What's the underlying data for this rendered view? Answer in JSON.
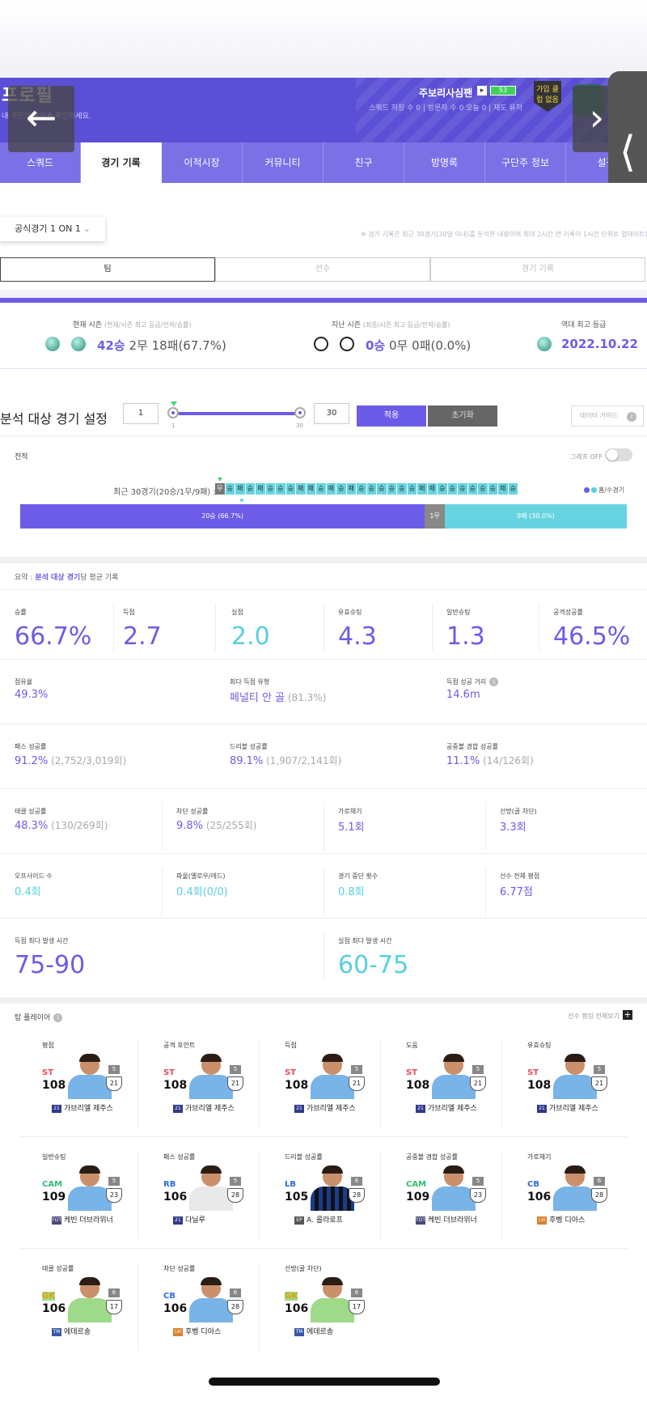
{
  "header": {
    "title": "프로필",
    "subtitle": "내 구단의 정보를 확인하세요.",
    "manager_name": "주보리사심팬",
    "level": "53",
    "meta": "스쿼드 저장 수 0 | 방문자 수 0 오늘 0 | 재도 유저",
    "club_badge": "가입 클럽 없음"
  },
  "tabs": [
    "스쿼드",
    "경기 기록",
    "이적시장",
    "커뮤니티",
    "친구",
    "방명록",
    "구단주 정보",
    "설정"
  ],
  "active_tab": "경기 기록",
  "filter": {
    "mode": "공식경기 1 ON 1",
    "note": "※ 경기 기록은 최근 30경기(30일 이내)를 분석한 내용이며 최대 2시간 전 기록이 1시간 단위로 업데이트됩니다."
  },
  "subtabs": [
    "팀",
    "선수",
    "경기 기록"
  ],
  "season": {
    "current_label": "현재 시즌",
    "current_sub": "(현재/시즌 최고 등급/전적/승률)",
    "current_win": "42승",
    "current_rest": " 2무 18패(67.7%)",
    "last_label": "지난 시즌",
    "last_sub": "(최종/시즌 최고 등급/전적/승률)",
    "last_win": "0승",
    "last_rest": " 0무 0패(0.0%)",
    "best_label": "역대 최고 등급",
    "best_date": "2022.10.22"
  },
  "analysis": {
    "title": "분석 대상 경기 설정",
    "min": "1",
    "max": "30",
    "tick_min": "1",
    "tick_max": "30",
    "apply": "적용",
    "reset": "초기화",
    "guide": "데이터 가이드"
  },
  "record": {
    "title": "전적",
    "toggle_label": "그래프 OFF",
    "recent_label": "최근 30경기(20승/1무/9패) :",
    "home_legend": "홈/수경기",
    "results": [
      "무",
      "승",
      "패",
      "승",
      "패",
      "승",
      "승",
      "승",
      "패",
      "패",
      "승",
      "패",
      "승",
      "패",
      "승",
      "승",
      "승",
      "승",
      "승",
      "승",
      "패",
      "패",
      "승",
      "승",
      "승",
      "승",
      "승",
      "승",
      "패",
      "승"
    ],
    "win_label": "20승 (66.7%)",
    "draw_label": "1무",
    "loss_label": "9패 (30.0%)",
    "win_pct": 66.7,
    "draw_pct": 3.3,
    "loss_pct": 30.0
  },
  "summary": {
    "prefix": "요약 : ",
    "highlight": "분석 대상 경기",
    "suffix": "당 평균 기록",
    "win_rate_l": "승률",
    "win_rate": "66.7%",
    "goals_l": "득점",
    "goals": "2.7",
    "conceded_l": "실점",
    "conceded": "2.0",
    "on_target_l": "유효슈팅",
    "on_target": "4.3",
    "shots_l": "일반슈팅",
    "shots": "1.3",
    "attack_l": "공격성공률",
    "attack": "46.5%",
    "possession_l": "점유율",
    "possession": "49.3%",
    "goal_type_l": "최다 득점 유형",
    "goal_type": "페널티 안 골",
    "goal_type_pct": " (81.3%)",
    "goal_dist_l": "득점 성공 거리",
    "goal_dist": "14.6m",
    "pass_l": "패스 성공률",
    "pass": "91.2%",
    "pass_sub": " (2,752/3,019회)",
    "dribble_l": "드리블 성공률",
    "dribble": "89.1%",
    "dribble_sub": " (1,907/2,141회)",
    "aerial_l": "공중볼 경합 성공률",
    "aerial": "11.1%",
    "aerial_sub": " (14/126회)",
    "tackle_l": "태클 성공률",
    "tackle": "48.3%",
    "tackle_sub": " (130/269회)",
    "block_l": "차단 성공률",
    "block": "9.8%",
    "block_sub": " (25/255회)",
    "intercept_l": "가로채기",
    "intercept": "5.1회",
    "save_l": "선방(골 차단)",
    "save": "3.3회",
    "offside_l": "오프사이드 수",
    "offside": "0.4회",
    "foul_l": "파울(옐로우/레드)",
    "foul": "0.4회(0/0)",
    "stop_l": "경기 중단 횟수",
    "stop": "0.8회",
    "rating_l": "선수 전체 평점",
    "rating": "6.77점",
    "goal_time_l": "득점 최다 발생 시간",
    "goal_time": "75-90",
    "concede_time_l": "실점 최다 발생 시간",
    "concede_time": "60-75"
  },
  "players": {
    "title": "탑 플레이어",
    "view_all": "선수 랭킹 전체보기",
    "rows": [
      [
        {
          "cat": "평점",
          "pos": "ST",
          "ovr": "108",
          "lvl": "5",
          "grade": "21",
          "season": "21",
          "name": "가브리엘 제주스",
          "kit": "sky",
          "pc": "st",
          "sb": "n21"
        },
        {
          "cat": "공격 포인트",
          "pos": "ST",
          "ovr": "108",
          "lvl": "5",
          "grade": "21",
          "season": "21",
          "name": "가브리엘 제주스",
          "kit": "sky",
          "pc": "st",
          "sb": "n21"
        },
        {
          "cat": "득점",
          "pos": "ST",
          "ovr": "108",
          "lvl": "5",
          "grade": "21",
          "season": "21",
          "name": "가브리엘 제주스",
          "kit": "sky",
          "pc": "st",
          "sb": "n21"
        },
        {
          "cat": "도움",
          "pos": "ST",
          "ovr": "108",
          "lvl": "5",
          "grade": "21",
          "season": "21",
          "name": "가브리엘 제주스",
          "kit": "sky",
          "pc": "st",
          "sb": "n21"
        },
        {
          "cat": "유효슈팅",
          "pos": "ST",
          "ovr": "108",
          "lvl": "5",
          "grade": "21",
          "season": "21",
          "name": "가브리엘 제주스",
          "kit": "sky",
          "pc": "st",
          "sb": "n21"
        }
      ],
      [
        {
          "cat": "일반슈팅",
          "pos": "CAM",
          "ovr": "109",
          "lvl": "5",
          "grade": "23",
          "season": "TOTS",
          "name": "케빈 더브라위너",
          "kit": "sky",
          "pc": "cam",
          "sb": "tots"
        },
        {
          "cat": "패스 성공률",
          "pos": "RB",
          "ovr": "106",
          "lvl": "5",
          "grade": "28",
          "season": "21",
          "name": "다닐루",
          "kit": "white",
          "pc": "rb",
          "sb": "n21"
        },
        {
          "cat": "드리블 성공률",
          "pos": "LB",
          "ovr": "105",
          "lvl": "6",
          "grade": "28",
          "season": "EP",
          "name": "A. 콜라로프",
          "kit": "inter",
          "pc": "lb",
          "sb": "ep"
        },
        {
          "cat": "공중볼 경합 성공률",
          "pos": "CAM",
          "ovr": "109",
          "lvl": "5",
          "grade": "23",
          "season": "TOTS",
          "name": "케빈 더브라위너",
          "kit": "sky",
          "pc": "cam",
          "sb": "tots"
        },
        {
          "cat": "가로채기",
          "pos": "CB",
          "ovr": "106",
          "lvl": "6",
          "grade": "28",
          "season": "LH",
          "name": "후벵 디아스",
          "kit": "sky",
          "pc": "cb",
          "sb": "lh"
        }
      ],
      [
        {
          "cat": "태클 성공률",
          "pos": "GK",
          "ovr": "106",
          "lvl": "6",
          "grade": "17",
          "season": "TM",
          "name": "에데르송",
          "kit": "gk",
          "pc": "gk",
          "sb": "tm"
        },
        {
          "cat": "차단 성공률",
          "pos": "CB",
          "ovr": "106",
          "lvl": "6",
          "grade": "28",
          "season": "LH",
          "name": "후벵 디아스",
          "kit": "sky",
          "pc": "cb",
          "sb": "lh"
        },
        {
          "cat": "선방(골 차단)",
          "pos": "GK",
          "ovr": "106",
          "lvl": "6",
          "grade": "17",
          "season": "TM",
          "name": "에데르송",
          "kit": "gk",
          "pc": "gk",
          "sb": "tm"
        }
      ]
    ]
  },
  "colors": {
    "purple": "#6c5ce7",
    "cyan": "#56d0e0",
    "draw": "#888888"
  }
}
